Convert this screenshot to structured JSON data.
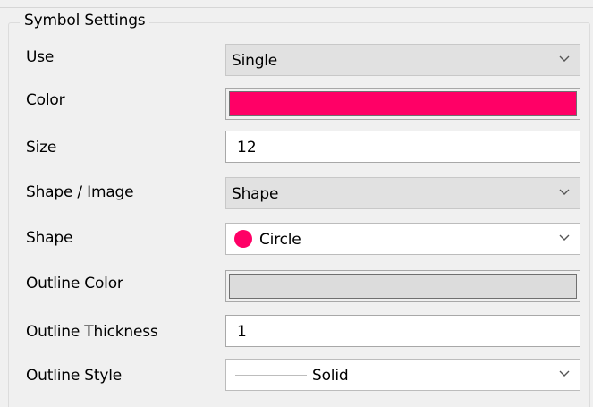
{
  "group": {
    "title": "Symbol Settings"
  },
  "colors": {
    "symbol_color": "#ff0066",
    "outline_color": "#dcdcdc",
    "shape_preview": "#ff0066"
  },
  "fields": {
    "use": {
      "label": "Use",
      "value": "Single",
      "icon": "chevron-down-icon"
    },
    "color": {
      "label": "Color"
    },
    "size": {
      "label": "Size",
      "value": "12"
    },
    "shape_image": {
      "label": "Shape / Image",
      "value": "Shape",
      "icon": "chevron-down-icon"
    },
    "shape": {
      "label": "Shape",
      "value": "Circle",
      "icon": "chevron-down-icon",
      "preview_icon": "circle-icon"
    },
    "outline_color": {
      "label": "Outline Color"
    },
    "outline_thickness": {
      "label": "Outline Thickness",
      "value": "1"
    },
    "outline_style": {
      "label": "Outline Style",
      "value": "Solid",
      "icon": "chevron-down-icon",
      "preview_icon": "solid-line-icon"
    }
  }
}
